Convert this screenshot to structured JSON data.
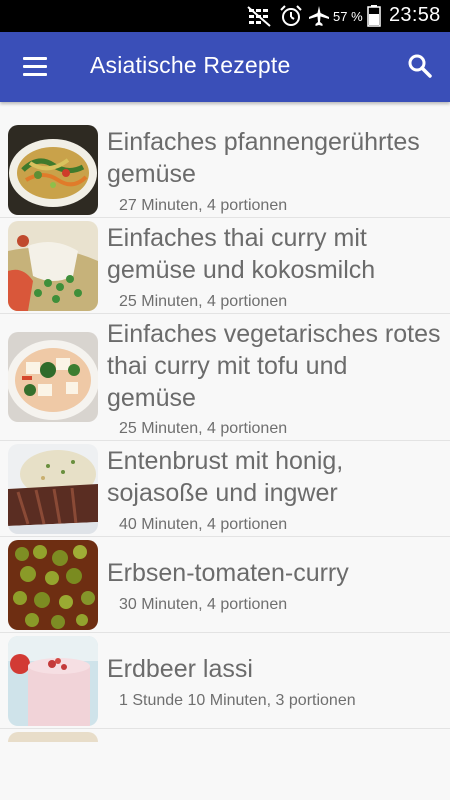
{
  "status_bar": {
    "battery_percent": "57 %",
    "time": "23:58",
    "icons": [
      "mute-icon",
      "alarm-icon",
      "airplane-mode-icon",
      "battery-icon"
    ]
  },
  "app_bar": {
    "title": "Asiatische Rezepte",
    "menu_icon": "hamburger-menu-icon",
    "search_icon": "search-icon"
  },
  "recipes": [
    {
      "title": "Einfaches pfannengerührtes gemüse",
      "meta": "27 Minuten, 4 portionen"
    },
    {
      "title": "Einfaches thai curry mit gemüse und kokosmilch",
      "meta": "25 Minuten, 4 portionen"
    },
    {
      "title": "Einfaches vegetarisches rotes thai curry mit tofu und gemüse",
      "meta": "25 Minuten, 4 portionen"
    },
    {
      "title": "Entenbrust mit honig, sojasoße und ingwer",
      "meta": "40 Minuten, 4 portionen"
    },
    {
      "title": "Erbsen-tomaten-curry",
      "meta": "30 Minuten, 4 portionen"
    },
    {
      "title": "Erdbeer lassi",
      "meta": "1 Stunde 10 Minuten, 3 portionen"
    }
  ],
  "colors": {
    "app_bar": "#3a4fb8",
    "status_bar": "#000000",
    "title_text": "#6b6b6b",
    "meta_text": "#6f6f6f"
  }
}
